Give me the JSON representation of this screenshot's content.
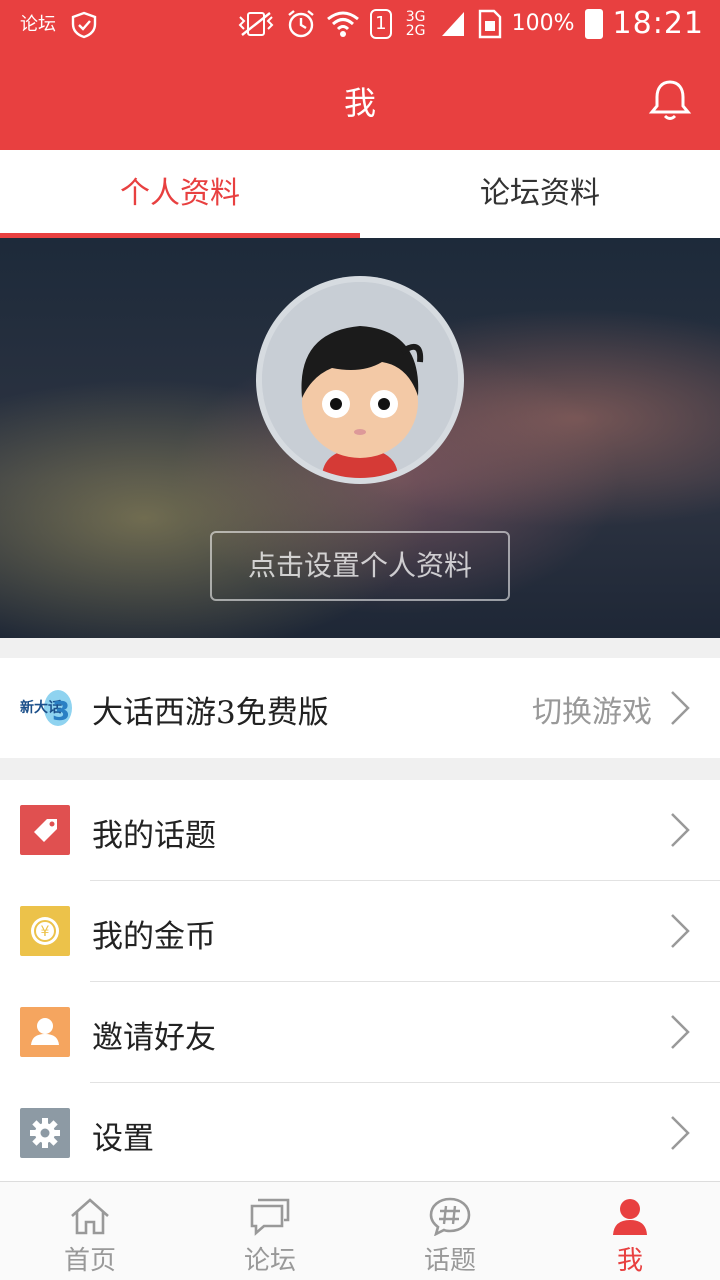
{
  "statusbar": {
    "left_app_label": "论坛",
    "sim_badge": "1",
    "network": "3G 2G",
    "battery": "100%",
    "time": "18:21"
  },
  "header": {
    "title": "我"
  },
  "tabs": [
    {
      "label": "个人资料",
      "active": true
    },
    {
      "label": "论坛资料",
      "active": false
    }
  ],
  "profile": {
    "set_profile_button": "点击设置个人资料"
  },
  "game": {
    "name": "大话西游3免费版",
    "switch_label": "切换游戏"
  },
  "menu": [
    {
      "label": "我的话题",
      "icon": "tag-icon",
      "color": "#e05050"
    },
    {
      "label": "我的金币",
      "icon": "coin-icon",
      "color": "#ecc24a"
    },
    {
      "label": "邀请好友",
      "icon": "invite-user-icon",
      "color": "#f5a55f"
    },
    {
      "label": "设置",
      "icon": "gear-icon",
      "color": "#8d9aa4"
    }
  ],
  "bottom_nav": [
    {
      "label": "首页",
      "icon": "home-icon",
      "active": false
    },
    {
      "label": "论坛",
      "icon": "forum-icon",
      "active": false
    },
    {
      "label": "话题",
      "icon": "hashtag-icon",
      "active": false
    },
    {
      "label": "我",
      "icon": "user-icon",
      "active": true
    }
  ],
  "colors": {
    "accent": "#e84040",
    "muted": "#999999"
  }
}
